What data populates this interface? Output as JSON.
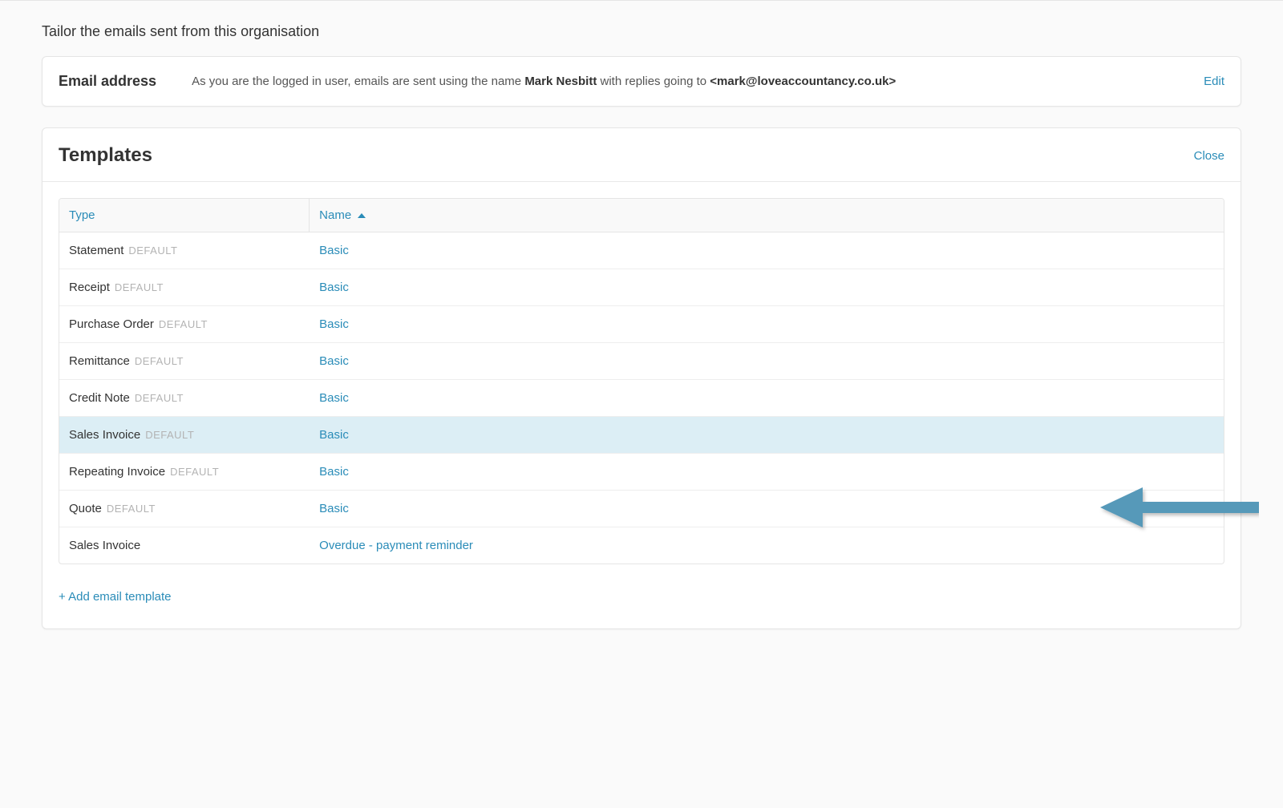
{
  "page": {
    "subtitle": "Tailor the emails sent from this organisation"
  },
  "emailBar": {
    "title": "Email address",
    "descPrefix": "As you are the logged in user, emails are sent using the name ",
    "userName": "Mark Nesbitt",
    "descMiddle": " with replies going to ",
    "userEmail": "<mark@loveaccountancy.co.uk>",
    "editLabel": "Edit"
  },
  "templates": {
    "title": "Templates",
    "closeLabel": "Close",
    "columns": {
      "type": "Type",
      "name": "Name"
    },
    "defaultBadge": "DEFAULT",
    "rows": [
      {
        "type": "Statement",
        "isDefault": true,
        "name": "Basic",
        "highlighted": false
      },
      {
        "type": "Receipt",
        "isDefault": true,
        "name": "Basic",
        "highlighted": false
      },
      {
        "type": "Purchase Order",
        "isDefault": true,
        "name": "Basic",
        "highlighted": false
      },
      {
        "type": "Remittance",
        "isDefault": true,
        "name": "Basic",
        "highlighted": false
      },
      {
        "type": "Credit Note",
        "isDefault": true,
        "name": "Basic",
        "highlighted": false
      },
      {
        "type": "Sales Invoice",
        "isDefault": true,
        "name": "Basic",
        "highlighted": true
      },
      {
        "type": "Repeating Invoice",
        "isDefault": true,
        "name": "Basic",
        "highlighted": false
      },
      {
        "type": "Quote",
        "isDefault": true,
        "name": "Basic",
        "highlighted": false
      },
      {
        "type": "Sales Invoice",
        "isDefault": false,
        "name": "Overdue - payment reminder",
        "highlighted": false
      }
    ],
    "addLabel": "+ Add email template"
  },
  "annotation": {
    "arrowColor": "#5799b9"
  }
}
